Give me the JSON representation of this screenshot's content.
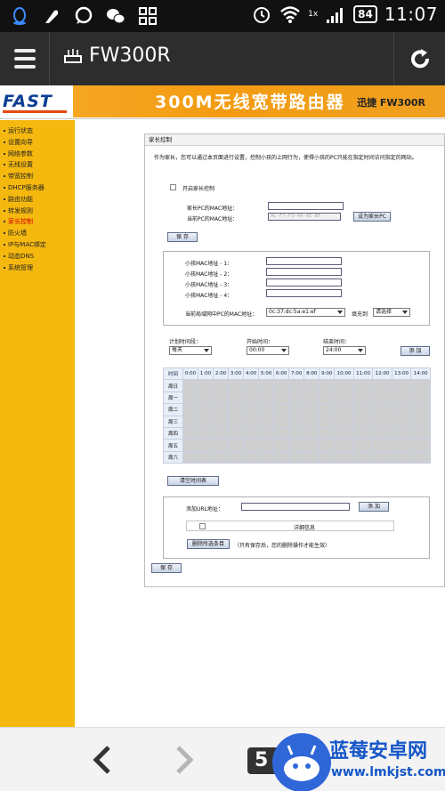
{
  "status_bar": {
    "battery": "84",
    "time": "11:07",
    "network_label": "1x"
  },
  "app_bar": {
    "title": "FW300R"
  },
  "router_header": {
    "logo": "FAST",
    "title": "300M无线宽带路由器",
    "model": "迅捷 FW300R"
  },
  "sidebar": {
    "items": [
      "运行状态",
      "设置向导",
      "网络参数",
      "无线设置",
      "带宽控制",
      "DHCP服务器",
      "路由功能",
      "转发规则",
      "家长控制",
      "防火墙",
      "IP与MAC绑定",
      "动态DNS",
      "系统管理"
    ],
    "active_index": 8
  },
  "panel": {
    "title": "家长控制",
    "description": "作为家长，您可以通过本页面进行设置，控制小孩的上网行为，使得小孩的PC只能在指定时间访问指定的网站。",
    "enable_label": "开启家长控制",
    "parent_mac_label": "家长PC的MAC地址：",
    "parent_mac_value": "",
    "current_mac_label": "当前PC的MAC地址：",
    "current_mac_value": "AC-F7-F3-49-A5-BF",
    "set_parent_button": "设为家长PC",
    "save_button": "保 存",
    "child_mac_labels": [
      "小孩MAC地址 - 1：",
      "小孩MAC地址 - 2：",
      "小孩MAC地址 - 3：",
      "小孩MAC地址 - 4："
    ],
    "lan_mac_label": "当前局域网中PC的MAC地址：",
    "lan_mac_value": "0c:37:dc:5a:e1:ef",
    "fill_to_label": "填充到",
    "fill_to_value": "请选择",
    "plan_time_label": "计划时间段：",
    "plan_time_value": "每天",
    "start_time_label": "开始时间：",
    "start_time_value": "00:00",
    "end_time_label": "结束时间：",
    "end_time_value": "24:00",
    "add_button": "添 加",
    "schedule": {
      "corner": "时间",
      "hours": [
        "0:00",
        "1:00",
        "2:00",
        "3:00",
        "4:00",
        "5:00",
        "6:00",
        "7:00",
        "8:00",
        "9:00",
        "10:00",
        "11:00",
        "12:00",
        "13:00",
        "14:00"
      ],
      "days": [
        "周日",
        "周一",
        "周二",
        "周三",
        "周四",
        "周五",
        "周六"
      ]
    },
    "clear_schedule_button": "清空时间表",
    "add_url_label": "添加URL地址：",
    "add_url_value": "",
    "add_url_button": "添 加",
    "details_header": "详细信息",
    "delete_selected_button": "删除所选条目",
    "delete_note": "（只有保存后，您的删除操作才能生效）",
    "bottom_save_button": "保 存"
  },
  "bottom_nav": {
    "tab_count": "5",
    "watermark_title": "蓝莓安卓网",
    "watermark_url": "www.lmkjst.com"
  }
}
